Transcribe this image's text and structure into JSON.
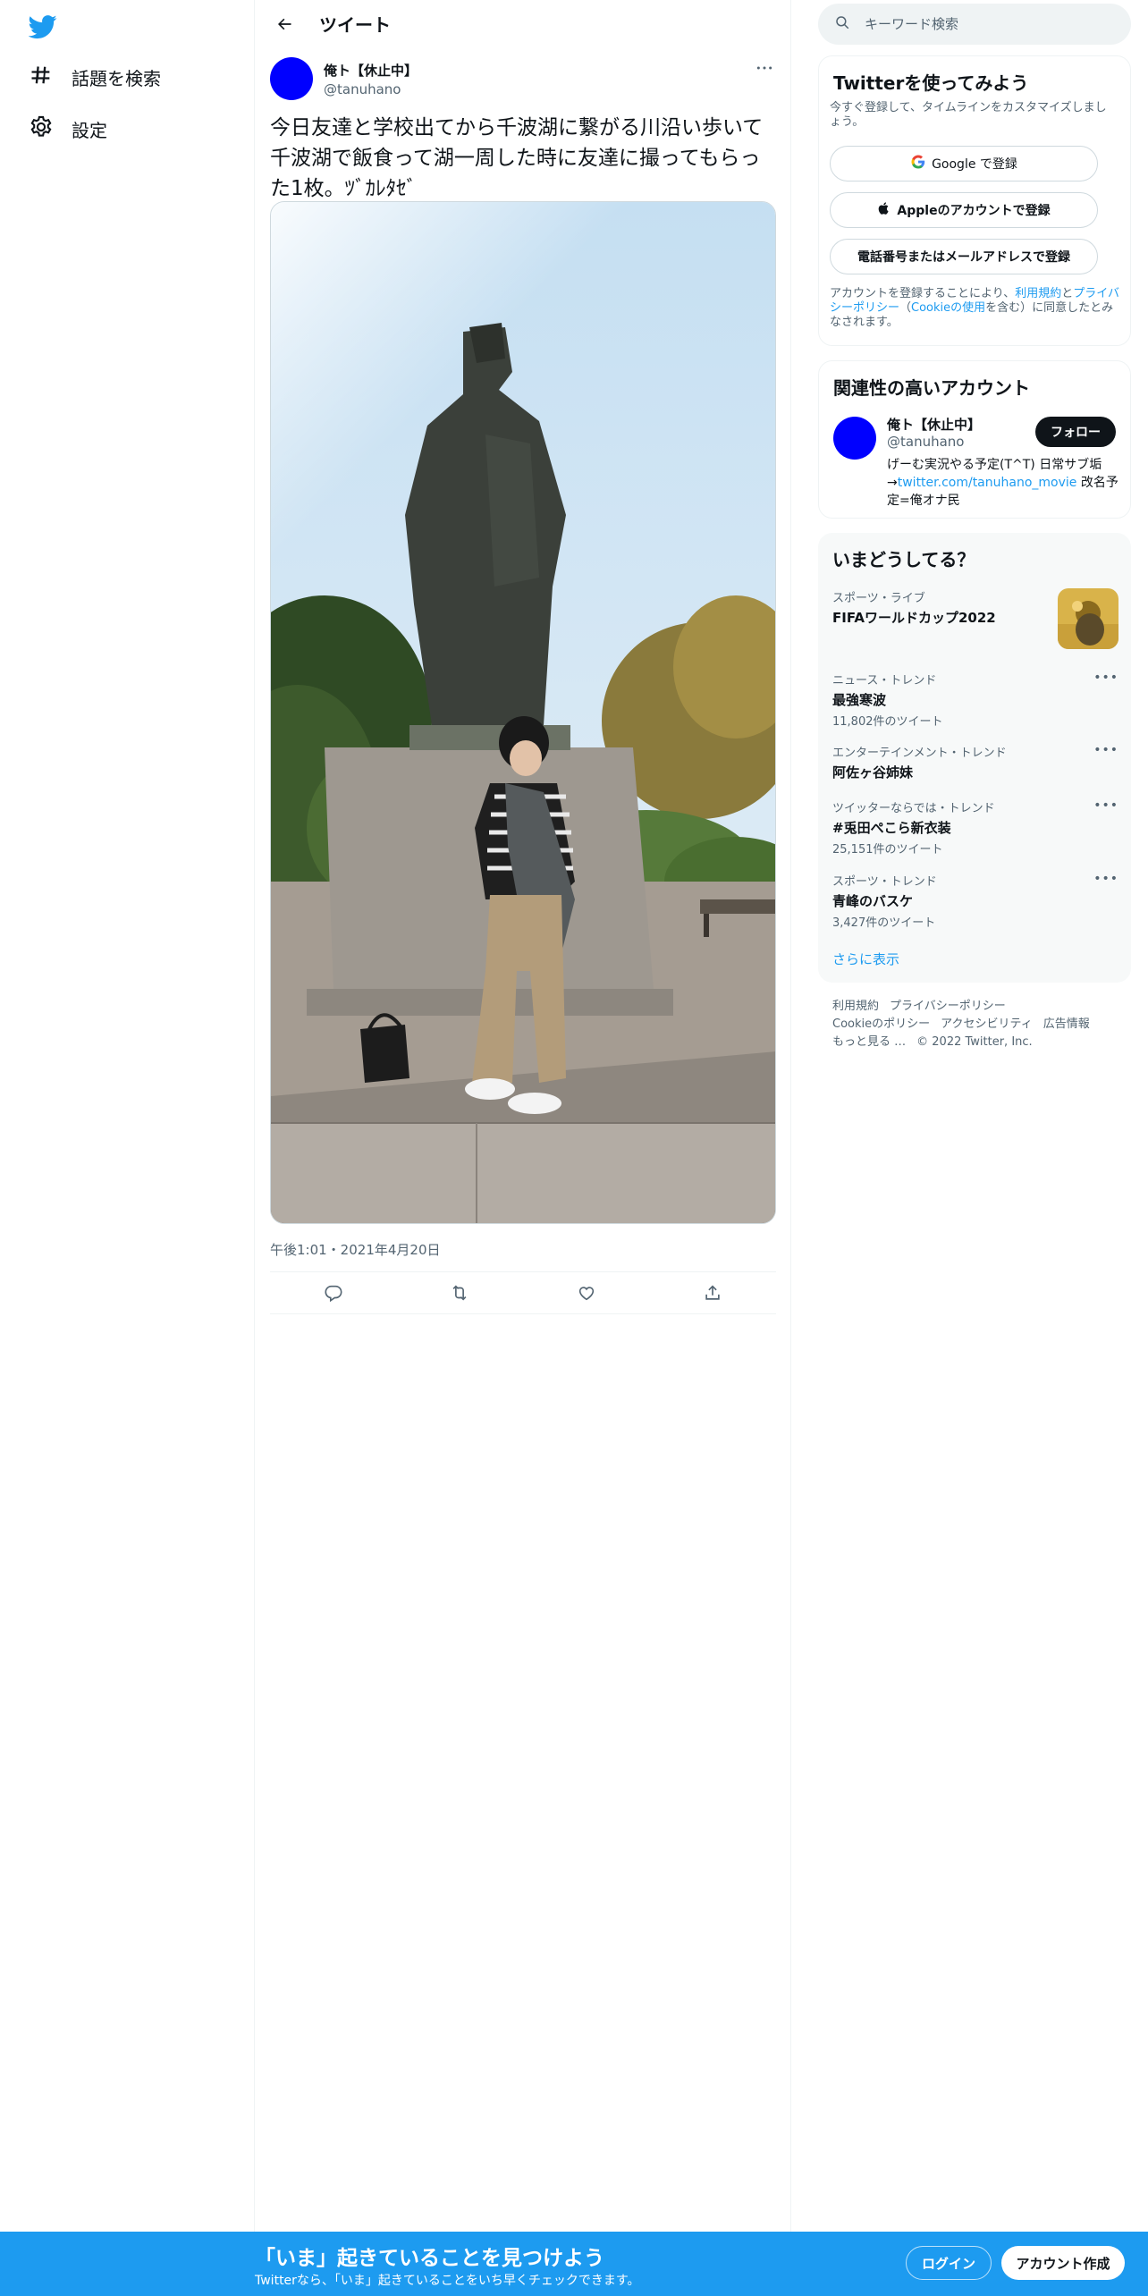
{
  "nav": {
    "logo_icon": "twitter-bird-icon",
    "items": [
      {
        "label": "話題を検索",
        "icon": "hashtag-icon"
      },
      {
        "label": "設定",
        "icon": "gear-icon"
      }
    ]
  },
  "header": {
    "title": "ツイート"
  },
  "tweet": {
    "author_name": "俺ト【休止中】",
    "author_handle": "@tanuhano",
    "text": "今日友達と学校出てから千波湖に繋がる川沿い歩いて千波湖で飯食って湖一周した時に友達に撮ってもらった1枚。ﾂﾞｶﾚﾀｾﾞ",
    "timestamp": "午後1:01・2021年4月20日"
  },
  "search": {
    "placeholder": "キーワード検索"
  },
  "signup_card": {
    "title": "Twitterを使ってみよう",
    "subtitle": "今すぐ登録して、タイムラインをカスタマイズしましょう。",
    "google_label": "Google で登録",
    "apple_label": "Appleのアカウントで登録",
    "phone_label": "電話番号またはメールアドレスで登録",
    "terms_prefix": "アカウントを登録することにより、",
    "terms_link": "利用規約",
    "terms_and": "と",
    "privacy_link": "プライバシーポリシー",
    "cookie_open": "（",
    "cookie_link": "Cookieの使用",
    "terms_suffix": "を含む）に同意したとみなされます。"
  },
  "relevant": {
    "title": "関連性の高いアカウント",
    "name": "俺ト【休止中】",
    "handle": "@tanuhano",
    "follow_label": "フォロー",
    "bio_1": "げーむ実況やる予定(T^T) 日常サブ垢→",
    "bio_link": "twitter.com/tanuhano_movie",
    "bio_2": " 改名予定=俺オナ民"
  },
  "trends": {
    "title": "いまどうしてる？",
    "items": [
      {
        "category": "スポーツ・ライブ",
        "name": "FIFAワールドカップ2022",
        "count": ""
      },
      {
        "category": "ニュース・トレンド",
        "name": "最強寒波",
        "count": "11,802件のツイート"
      },
      {
        "category": "エンターテインメント・トレンド",
        "name": "阿佐ヶ谷姉妹",
        "count": ""
      },
      {
        "category": "ツイッターならでは・トレンド",
        "name": "#兎田ぺこら新衣装",
        "count": "25,151件のツイート"
      },
      {
        "category": "スポーツ・トレンド",
        "name": "青峰のバスケ",
        "count": "3,427件のツイート"
      }
    ],
    "show_more": "さらに表示"
  },
  "footer": {
    "terms": "利用規約",
    "privacy": "プライバシーポリシー",
    "cookie": "Cookieのポリシー",
    "accessibility": "アクセシビリティ",
    "ads": "広告情報",
    "more": "もっと見る …",
    "copyright": "© 2022 Twitter, Inc."
  },
  "banner": {
    "title": "「いま」起きていることを見つけよう",
    "subtitle": "Twitterなら、「いま」起きていることをいち早くチェックできます。",
    "login": "ログイン",
    "signup": "アカウント作成"
  },
  "colors": {
    "accent": "#1d9bf0",
    "text": "#0f1419",
    "muted": "#536471"
  }
}
